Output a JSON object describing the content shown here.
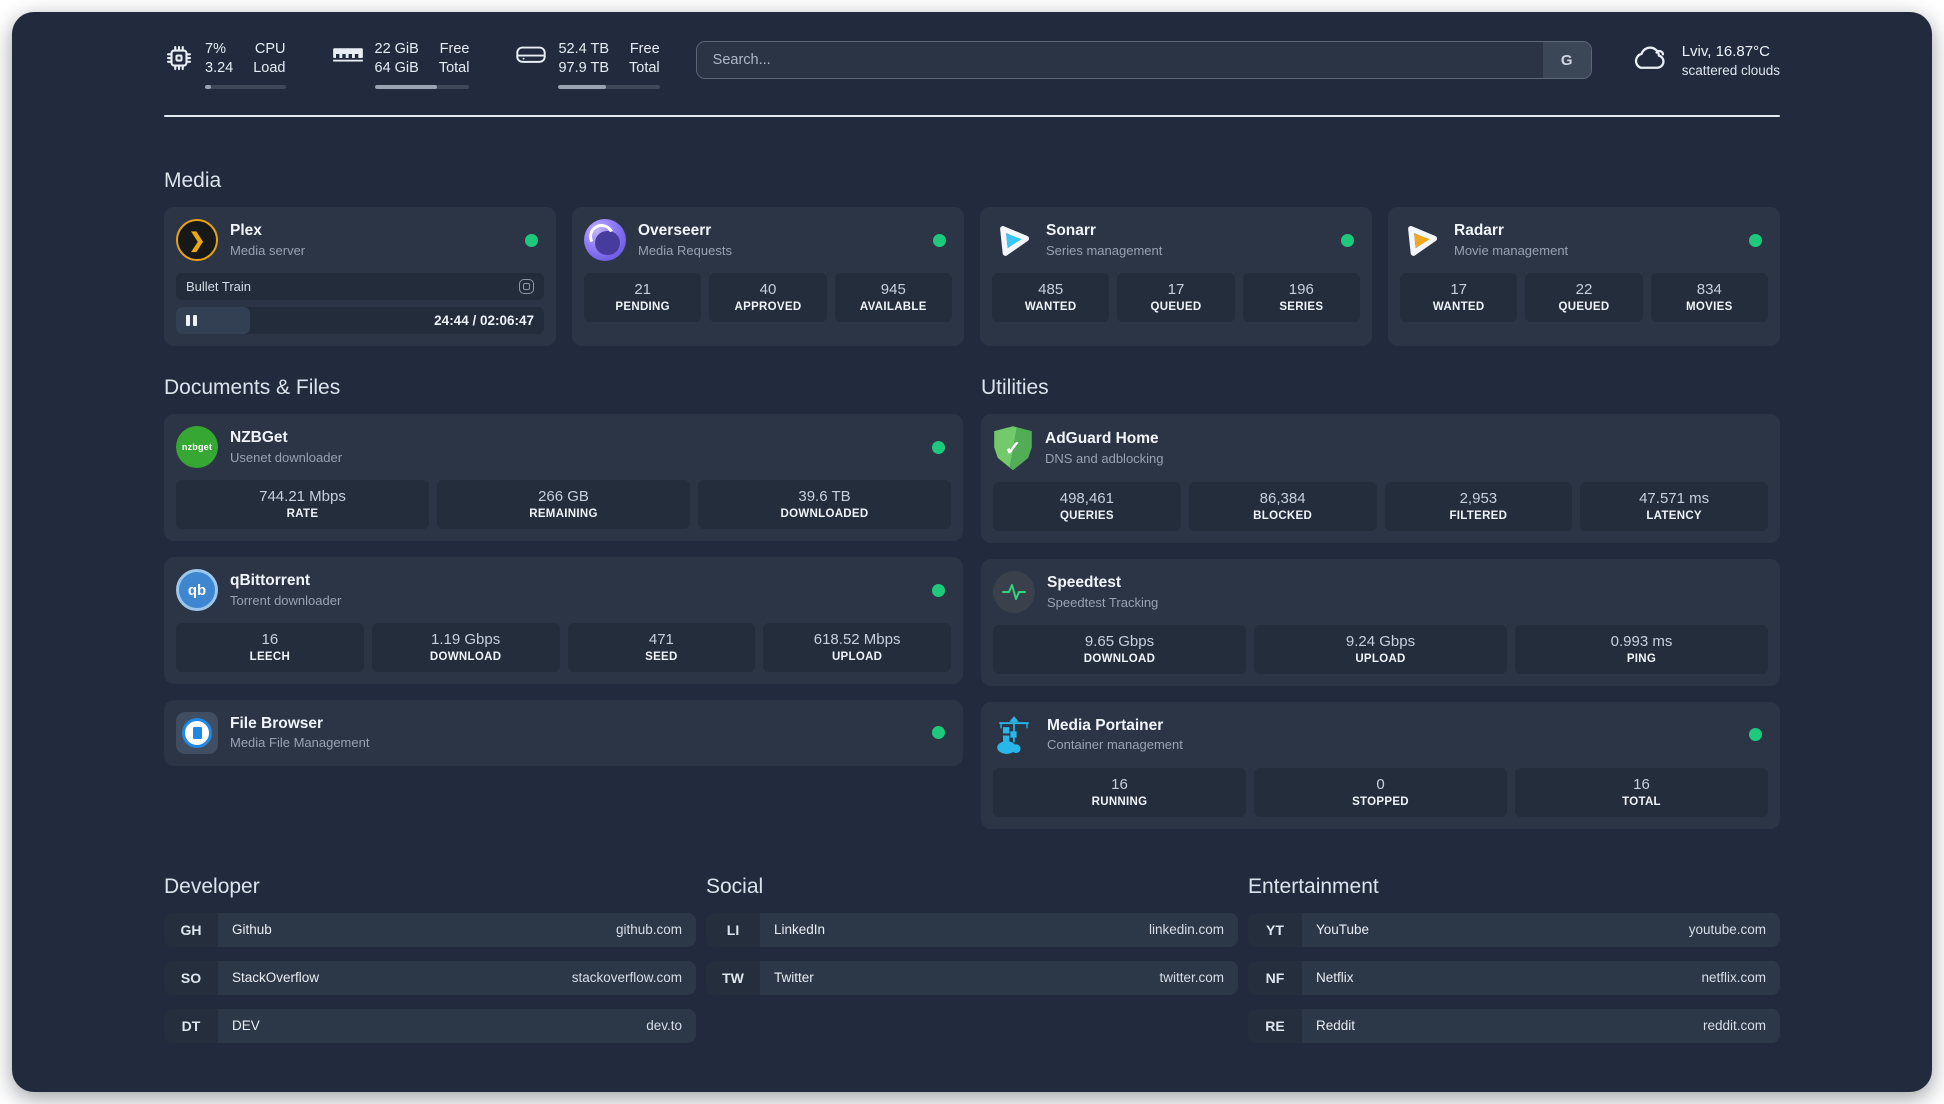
{
  "colors": {
    "status_online": "#1ec97c",
    "accent": "#29b6e8"
  },
  "topbar": {
    "metrics": [
      {
        "icon": "cpu-icon",
        "value_primary": "7%",
        "value_secondary": "3.24",
        "label_primary": "CPU",
        "label_secondary": "Load",
        "progress_pct": 8
      },
      {
        "icon": "memory-icon",
        "value_primary": "22 GiB",
        "value_secondary": "64 GiB",
        "label_primary": "Free",
        "label_secondary": "Total",
        "progress_pct": 66
      },
      {
        "icon": "disk-icon",
        "value_primary": "52.4 TB",
        "value_secondary": "97.9 TB",
        "label_primary": "Free",
        "label_secondary": "Total",
        "progress_pct": 47
      }
    ],
    "search": {
      "placeholder": "Search...",
      "engine_button": "G"
    },
    "weather": {
      "icon": "cloud-icon",
      "location_temperature": "Lviv, 16.87°C",
      "condition": "scattered clouds"
    }
  },
  "media": {
    "title": "Media",
    "plex": {
      "name": "Plex",
      "description": "Media server",
      "status": "online",
      "icon": "plex-icon",
      "now_playing": {
        "title": "Bullet Train",
        "time": "24:44 / 02:06:47",
        "progress_pct": 20,
        "state": "paused"
      }
    },
    "overseerr": {
      "name": "Overseerr",
      "description": "Media Requests",
      "status": "online",
      "icon": "overseerr-icon",
      "stats": [
        {
          "value": "21",
          "label": "PENDING"
        },
        {
          "value": "40",
          "label": "APPROVED"
        },
        {
          "value": "945",
          "label": "AVAILABLE"
        }
      ]
    },
    "sonarr": {
      "name": "Sonarr",
      "description": "Series management",
      "status": "online",
      "icon": "sonarr-icon",
      "stats": [
        {
          "value": "485",
          "label": "WANTED"
        },
        {
          "value": "17",
          "label": "QUEUED"
        },
        {
          "value": "196",
          "label": "SERIES"
        }
      ]
    },
    "radarr": {
      "name": "Radarr",
      "description": "Movie management",
      "status": "online",
      "icon": "radarr-icon",
      "stats": [
        {
          "value": "17",
          "label": "WANTED"
        },
        {
          "value": "22",
          "label": "QUEUED"
        },
        {
          "value": "834",
          "label": "MOVIES"
        }
      ]
    }
  },
  "documents": {
    "title": "Documents & Files",
    "nzbget": {
      "name": "NZBGet",
      "description": "Usenet downloader",
      "status": "online",
      "icon": "nzbget-icon",
      "icon_text": "nzbget",
      "stats": [
        {
          "value": "744.21 Mbps",
          "label": "RATE"
        },
        {
          "value": "266 GB",
          "label": "REMAINING"
        },
        {
          "value": "39.6 TB",
          "label": "DOWNLOADED"
        }
      ]
    },
    "qbittorrent": {
      "name": "qBittorrent",
      "description": "Torrent downloader",
      "status": "online",
      "icon": "qbittorrent-icon",
      "icon_text": "qb",
      "stats": [
        {
          "value": "16",
          "label": "LEECH"
        },
        {
          "value": "1.19 Gbps",
          "label": "DOWNLOAD"
        },
        {
          "value": "471",
          "label": "SEED"
        },
        {
          "value": "618.52 Mbps",
          "label": "UPLOAD"
        }
      ]
    },
    "filebrowser": {
      "name": "File Browser",
      "description": "Media File Management",
      "status": "online",
      "icon": "filebrowser-icon"
    }
  },
  "utilities": {
    "title": "Utilities",
    "adguard": {
      "name": "AdGuard Home",
      "description": "DNS and adblocking",
      "icon": "adguard-icon",
      "icon_glyph": "✓",
      "stats": [
        {
          "value": "498,461",
          "label": "QUERIES"
        },
        {
          "value": "86,384",
          "label": "BLOCKED"
        },
        {
          "value": "2,953",
          "label": "FILTERED"
        },
        {
          "value": "47.571 ms",
          "label": "LATENCY"
        }
      ]
    },
    "speedtest": {
      "name": "Speedtest",
      "description": "Speedtest Tracking",
      "icon": "speedtest-icon",
      "stats": [
        {
          "value": "9.65 Gbps",
          "label": "DOWNLOAD"
        },
        {
          "value": "9.24 Gbps",
          "label": "UPLOAD"
        },
        {
          "value": "0.993 ms",
          "label": "PING"
        }
      ]
    },
    "portainer": {
      "name": "Media Portainer",
      "description": "Container management",
      "status": "online",
      "icon": "portainer-icon",
      "stats": [
        {
          "value": "16",
          "label": "RUNNING"
        },
        {
          "value": "0",
          "label": "STOPPED"
        },
        {
          "value": "16",
          "label": "TOTAL"
        }
      ]
    }
  },
  "bookmarks": {
    "developer": {
      "title": "Developer",
      "links": [
        {
          "abbr": "GH",
          "name": "Github",
          "url": "github.com"
        },
        {
          "abbr": "SO",
          "name": "StackOverflow",
          "url": "stackoverflow.com"
        },
        {
          "abbr": "DT",
          "name": "DEV",
          "url": "dev.to"
        }
      ]
    },
    "social": {
      "title": "Social",
      "links": [
        {
          "abbr": "LI",
          "name": "LinkedIn",
          "url": "linkedin.com"
        },
        {
          "abbr": "TW",
          "name": "Twitter",
          "url": "twitter.com"
        }
      ]
    },
    "entertainment": {
      "title": "Entertainment",
      "links": [
        {
          "abbr": "YT",
          "name": "YouTube",
          "url": "youtube.com"
        },
        {
          "abbr": "NF",
          "name": "Netflix",
          "url": "netflix.com"
        },
        {
          "abbr": "RE",
          "name": "Reddit",
          "url": "reddit.com"
        }
      ]
    }
  }
}
